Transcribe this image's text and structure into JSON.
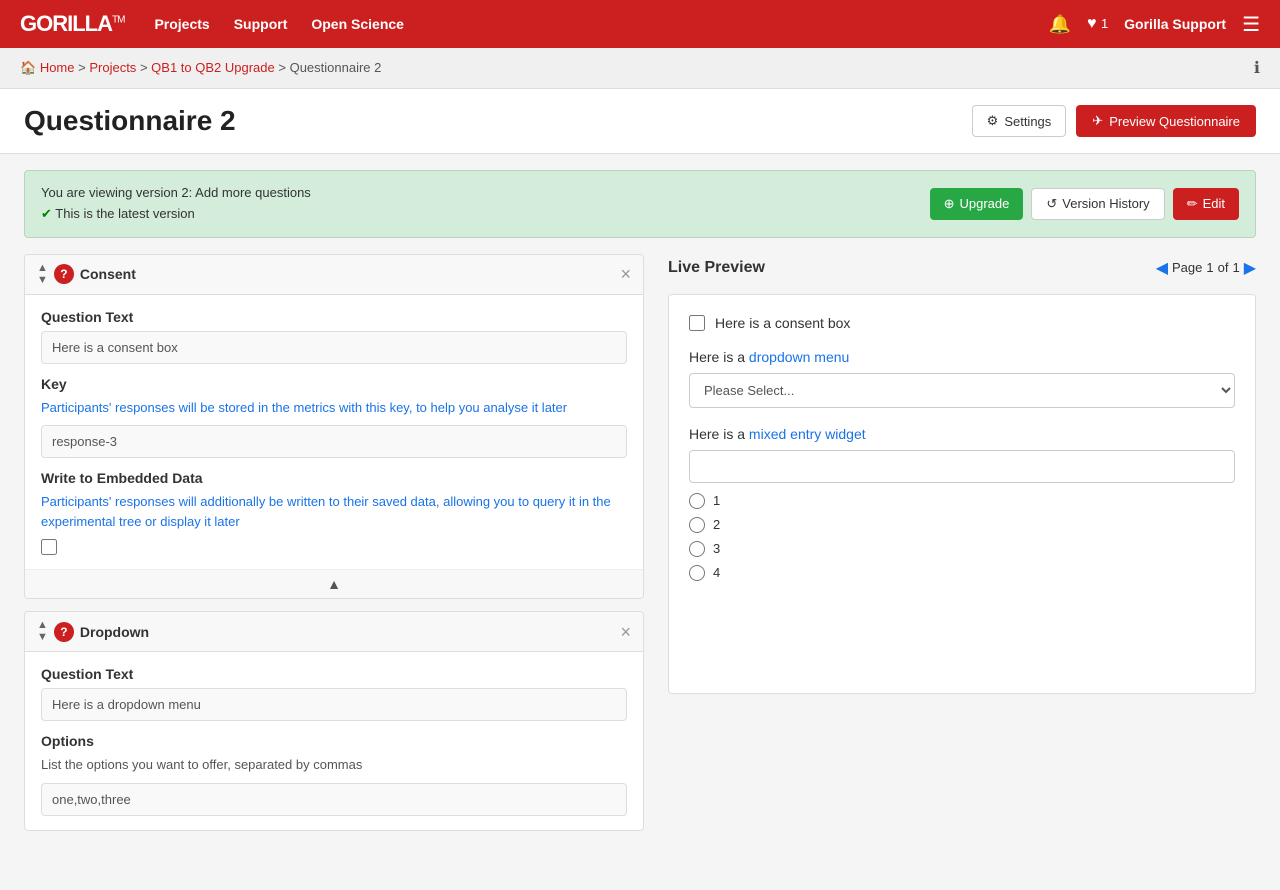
{
  "navbar": {
    "brand": "GORILLA",
    "brand_tm": "TM",
    "links": [
      "Projects",
      "Support",
      "Open Science"
    ],
    "heart_count": "1",
    "user_name": "Gorilla Support"
  },
  "breadcrumb": {
    "home": "Home",
    "projects": "Projects",
    "project": "QB1 to QB2 Upgrade",
    "current": "Questionnaire 2"
  },
  "page": {
    "title": "Questionnaire 2",
    "settings_label": "Settings",
    "preview_label": "Preview Questionnaire"
  },
  "version_banner": {
    "line1": "You are viewing version 2: Add more questions",
    "line2": "This is the latest version",
    "upgrade_label": "Upgrade",
    "history_label": "Version History",
    "edit_label": "Edit"
  },
  "consent_card": {
    "type": "Consent",
    "question_text_label": "Question Text",
    "question_text_value": "Here is a consent box",
    "key_label": "Key",
    "key_desc_prefix": "Participants' responses will be stored in the metrics with this key, ",
    "key_desc_highlight": "to help you analyse it later",
    "key_value": "response-3",
    "embedded_label": "Write to Embedded Data",
    "embedded_desc_prefix": "Participants' responses will additionally be written to their saved data, ",
    "embedded_desc_highlight": "allowing you to query it in the experimental tree or display it later"
  },
  "dropdown_card": {
    "type": "Dropdown",
    "question_text_label": "Question Text",
    "question_text_value": "Here is a dropdown menu",
    "options_label": "Options",
    "options_desc": "List the options you want to offer, separated by commas",
    "options_value": "one,two,three"
  },
  "live_preview": {
    "title": "Live Preview",
    "page_label": "Page",
    "page_current": "1",
    "page_of": "of",
    "page_total": "1",
    "consent_text": "Here is a consent box",
    "dropdown_label_prefix": "Here is a ",
    "dropdown_label_highlight": "dropdown menu",
    "dropdown_placeholder": "Please Select...",
    "mixed_label_prefix": "Here is a ",
    "mixed_label_highlight": "mixed entry widget",
    "radio_options": [
      "1",
      "2",
      "3",
      "4"
    ]
  }
}
